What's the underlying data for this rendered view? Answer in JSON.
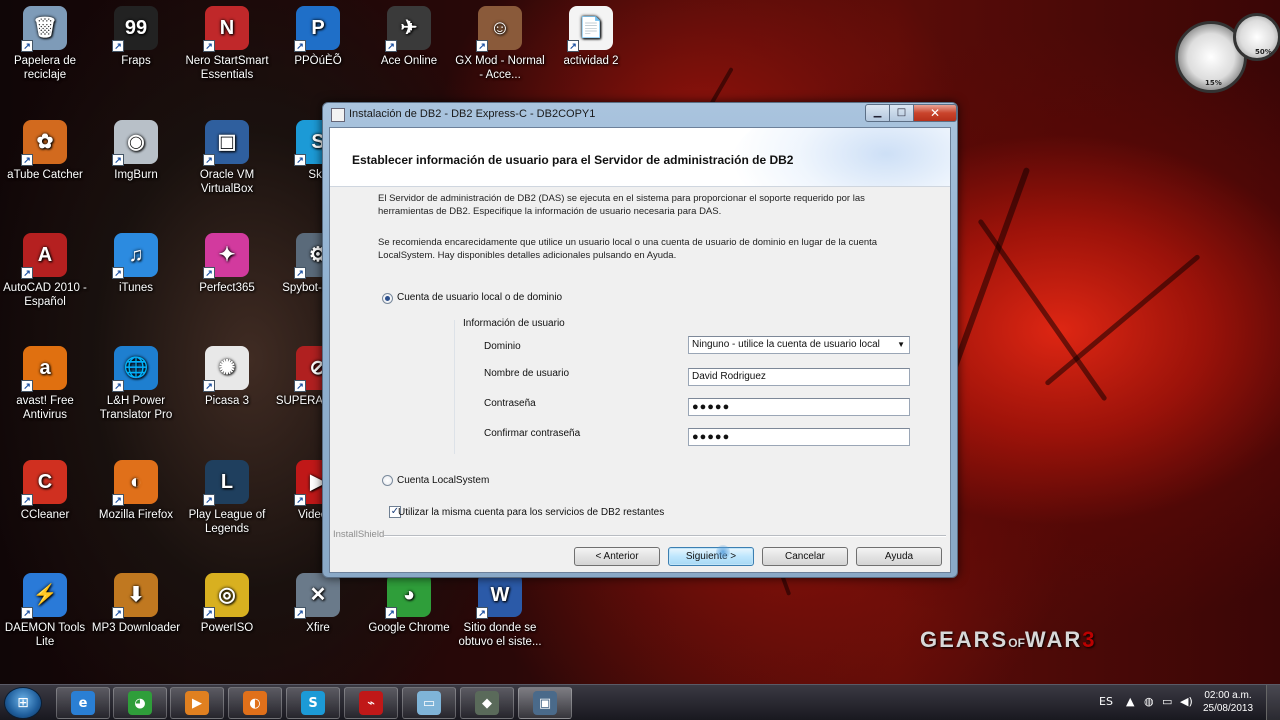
{
  "desktop": {
    "icons": [
      {
        "name": "recycle-bin-icon",
        "label": "Papelera de reciclaje",
        "glyph": "🗑",
        "color": "#7e9bb8"
      },
      {
        "name": "fraps-icon",
        "label": "Fraps",
        "glyph": "99",
        "color": "#222222"
      },
      {
        "name": "nero-icon",
        "label": "Nero StartSmart Essentials",
        "glyph": "N",
        "color": "#c0282a"
      },
      {
        "name": "pp-icon",
        "label": "PPÒúÈÕ",
        "glyph": "P",
        "color": "#1f6fc8"
      },
      {
        "name": "ace-online-icon",
        "label": "Ace Online",
        "glyph": "✈",
        "color": "#3a3a3a"
      },
      {
        "name": "gx-mod-icon",
        "label": "GX Mod - Normal - Acce...",
        "glyph": "☺",
        "color": "#8a5a3a"
      },
      {
        "name": "pdf-file-icon",
        "label": "actividad 2",
        "glyph": "📄",
        "color": "#f4f4f4"
      },
      {
        "name": "atube-catcher-icon",
        "label": "aTube Catcher",
        "glyph": "✿",
        "color": "#d26a1e"
      },
      {
        "name": "imgburn-icon",
        "label": "ImgBurn",
        "glyph": "◉",
        "color": "#b8c0c8"
      },
      {
        "name": "virtualbox-icon",
        "label": "Oracle VM VirtualBox",
        "glyph": "▣",
        "color": "#2f5f9e"
      },
      {
        "name": "skype-icon",
        "label": "Sky",
        "glyph": "S",
        "color": "#1c9ad6"
      },
      {
        "name": "autocad-icon",
        "label": "AutoCAD 2010 - Español",
        "glyph": "A",
        "color": "#b52020"
      },
      {
        "name": "itunes-icon",
        "label": "iTunes",
        "glyph": "♫",
        "color": "#2c8be0"
      },
      {
        "name": "perfect365-icon",
        "label": "Perfect365",
        "glyph": "✦",
        "color": "#d23a9e"
      },
      {
        "name": "spybot-icon",
        "label": "Spybot-S Cen",
        "glyph": "⚙",
        "color": "#5a6a7a"
      },
      {
        "name": "avast-icon",
        "label": "avast! Free Antivirus",
        "glyph": "a",
        "color": "#e07010"
      },
      {
        "name": "lh-power-icon",
        "label": "L&H Power Translator Pro",
        "glyph": "🌐",
        "color": "#1e7fd0"
      },
      {
        "name": "picasa-icon",
        "label": "Picasa 3",
        "glyph": "✺",
        "color": "#e8e8e8"
      },
      {
        "name": "superantispyware-icon",
        "label": "SUPERA Free E",
        "glyph": "⊘",
        "color": "#b02020"
      },
      {
        "name": "ccleaner-icon",
        "label": "CCleaner",
        "glyph": "C",
        "color": "#d03020"
      },
      {
        "name": "firefox-icon",
        "label": "Mozilla Firefox",
        "glyph": "◐",
        "color": "#e0701a"
      },
      {
        "name": "league-icon",
        "label": "Play League of Legends",
        "glyph": "L",
        "color": "#1f3f5e"
      },
      {
        "name": "youtube-icon",
        "label": "Video S",
        "glyph": "▶",
        "color": "#c01818"
      },
      {
        "name": "daemon-tools-icon",
        "label": "DAEMON Tools Lite",
        "glyph": "⚡",
        "color": "#2a7ad8"
      },
      {
        "name": "mp3-downloader-icon",
        "label": "MP3 Downloader",
        "glyph": "⬇",
        "color": "#c07820"
      },
      {
        "name": "poweriso-icon",
        "label": "PowerISO",
        "glyph": "◎",
        "color": "#d8b020"
      },
      {
        "name": "xfire-icon",
        "label": "Xfire",
        "glyph": "✕",
        "color": "#6a7a8a"
      },
      {
        "name": "chrome-icon",
        "label": "Google Chrome",
        "glyph": "◕",
        "color": "#2f9e3a"
      },
      {
        "name": "word-doc-icon",
        "label": "Sitio donde se obtuvo el siste...",
        "glyph": "W",
        "color": "#2b5aa8"
      }
    ],
    "gadget": {
      "cpu": "15%",
      "mem": "50%"
    },
    "wallpaper_logo": {
      "main": "GEARS",
      "of": "OF",
      "war": "WAR",
      "num": "3"
    }
  },
  "window": {
    "title": "Instalación de DB2 - DB2 Express-C - DB2COPY1",
    "header_title": "Establecer información de usuario para el Servidor de administración de DB2",
    "para1": "El Servidor de administración de DB2 (DAS) se ejecuta en el sistema para proporcionar el soporte requerido por las herramientas de DB2. Especifique la información de usuario necesaria para DAS.",
    "para2": "Se recomienda encarecidamente que utilice un usuario local o una cuenta de usuario de dominio en lugar de la cuenta LocalSystem. Hay disponibles detalles adicionales pulsando en Ayuda.",
    "radio_domain": "Cuenta de usuario local o de dominio",
    "group_title": "Información de usuario",
    "label_domain": "Dominio",
    "domain_value": "Ninguno - utilice la cuenta de usuario local",
    "label_user": "Nombre de usuario",
    "user_value": "David Rodriguez",
    "label_password": "Contraseña",
    "password_value": "●●●●●",
    "label_confirm": "Confirmar contraseña",
    "confirm_value": "●●●●●",
    "radio_localsystem": "Cuenta LocalSystem",
    "checkbox_label": "Utilizar la misma cuenta para los servicios de DB2 restantes",
    "installshield": "InstallShield",
    "btn_back": "< Anterior",
    "btn_next": "Siguiente >",
    "btn_cancel": "Cancelar",
    "btn_help": "Ayuda"
  },
  "taskbar": {
    "items": [
      {
        "name": "taskbar-ie",
        "glyph": "e",
        "color": "#2a7fd4"
      },
      {
        "name": "taskbar-chrome",
        "glyph": "◕",
        "color": "#2f9e3a"
      },
      {
        "name": "taskbar-media",
        "glyph": "▶",
        "color": "#e08020"
      },
      {
        "name": "taskbar-firefox",
        "glyph": "◐",
        "color": "#e0701a"
      },
      {
        "name": "taskbar-skype",
        "glyph": "S",
        "color": "#1c9ad6"
      },
      {
        "name": "taskbar-pdf",
        "glyph": "⌁",
        "color": "#c01818"
      },
      {
        "name": "taskbar-explorer",
        "glyph": "▭",
        "color": "#7fb4d8"
      },
      {
        "name": "taskbar-app",
        "glyph": "◆",
        "color": "#5a6a5a"
      },
      {
        "name": "taskbar-installer",
        "glyph": "▣",
        "color": "#4a6a8a"
      }
    ],
    "language": "ES",
    "time": "02:00 a.m.",
    "date": "25/08/2013"
  }
}
